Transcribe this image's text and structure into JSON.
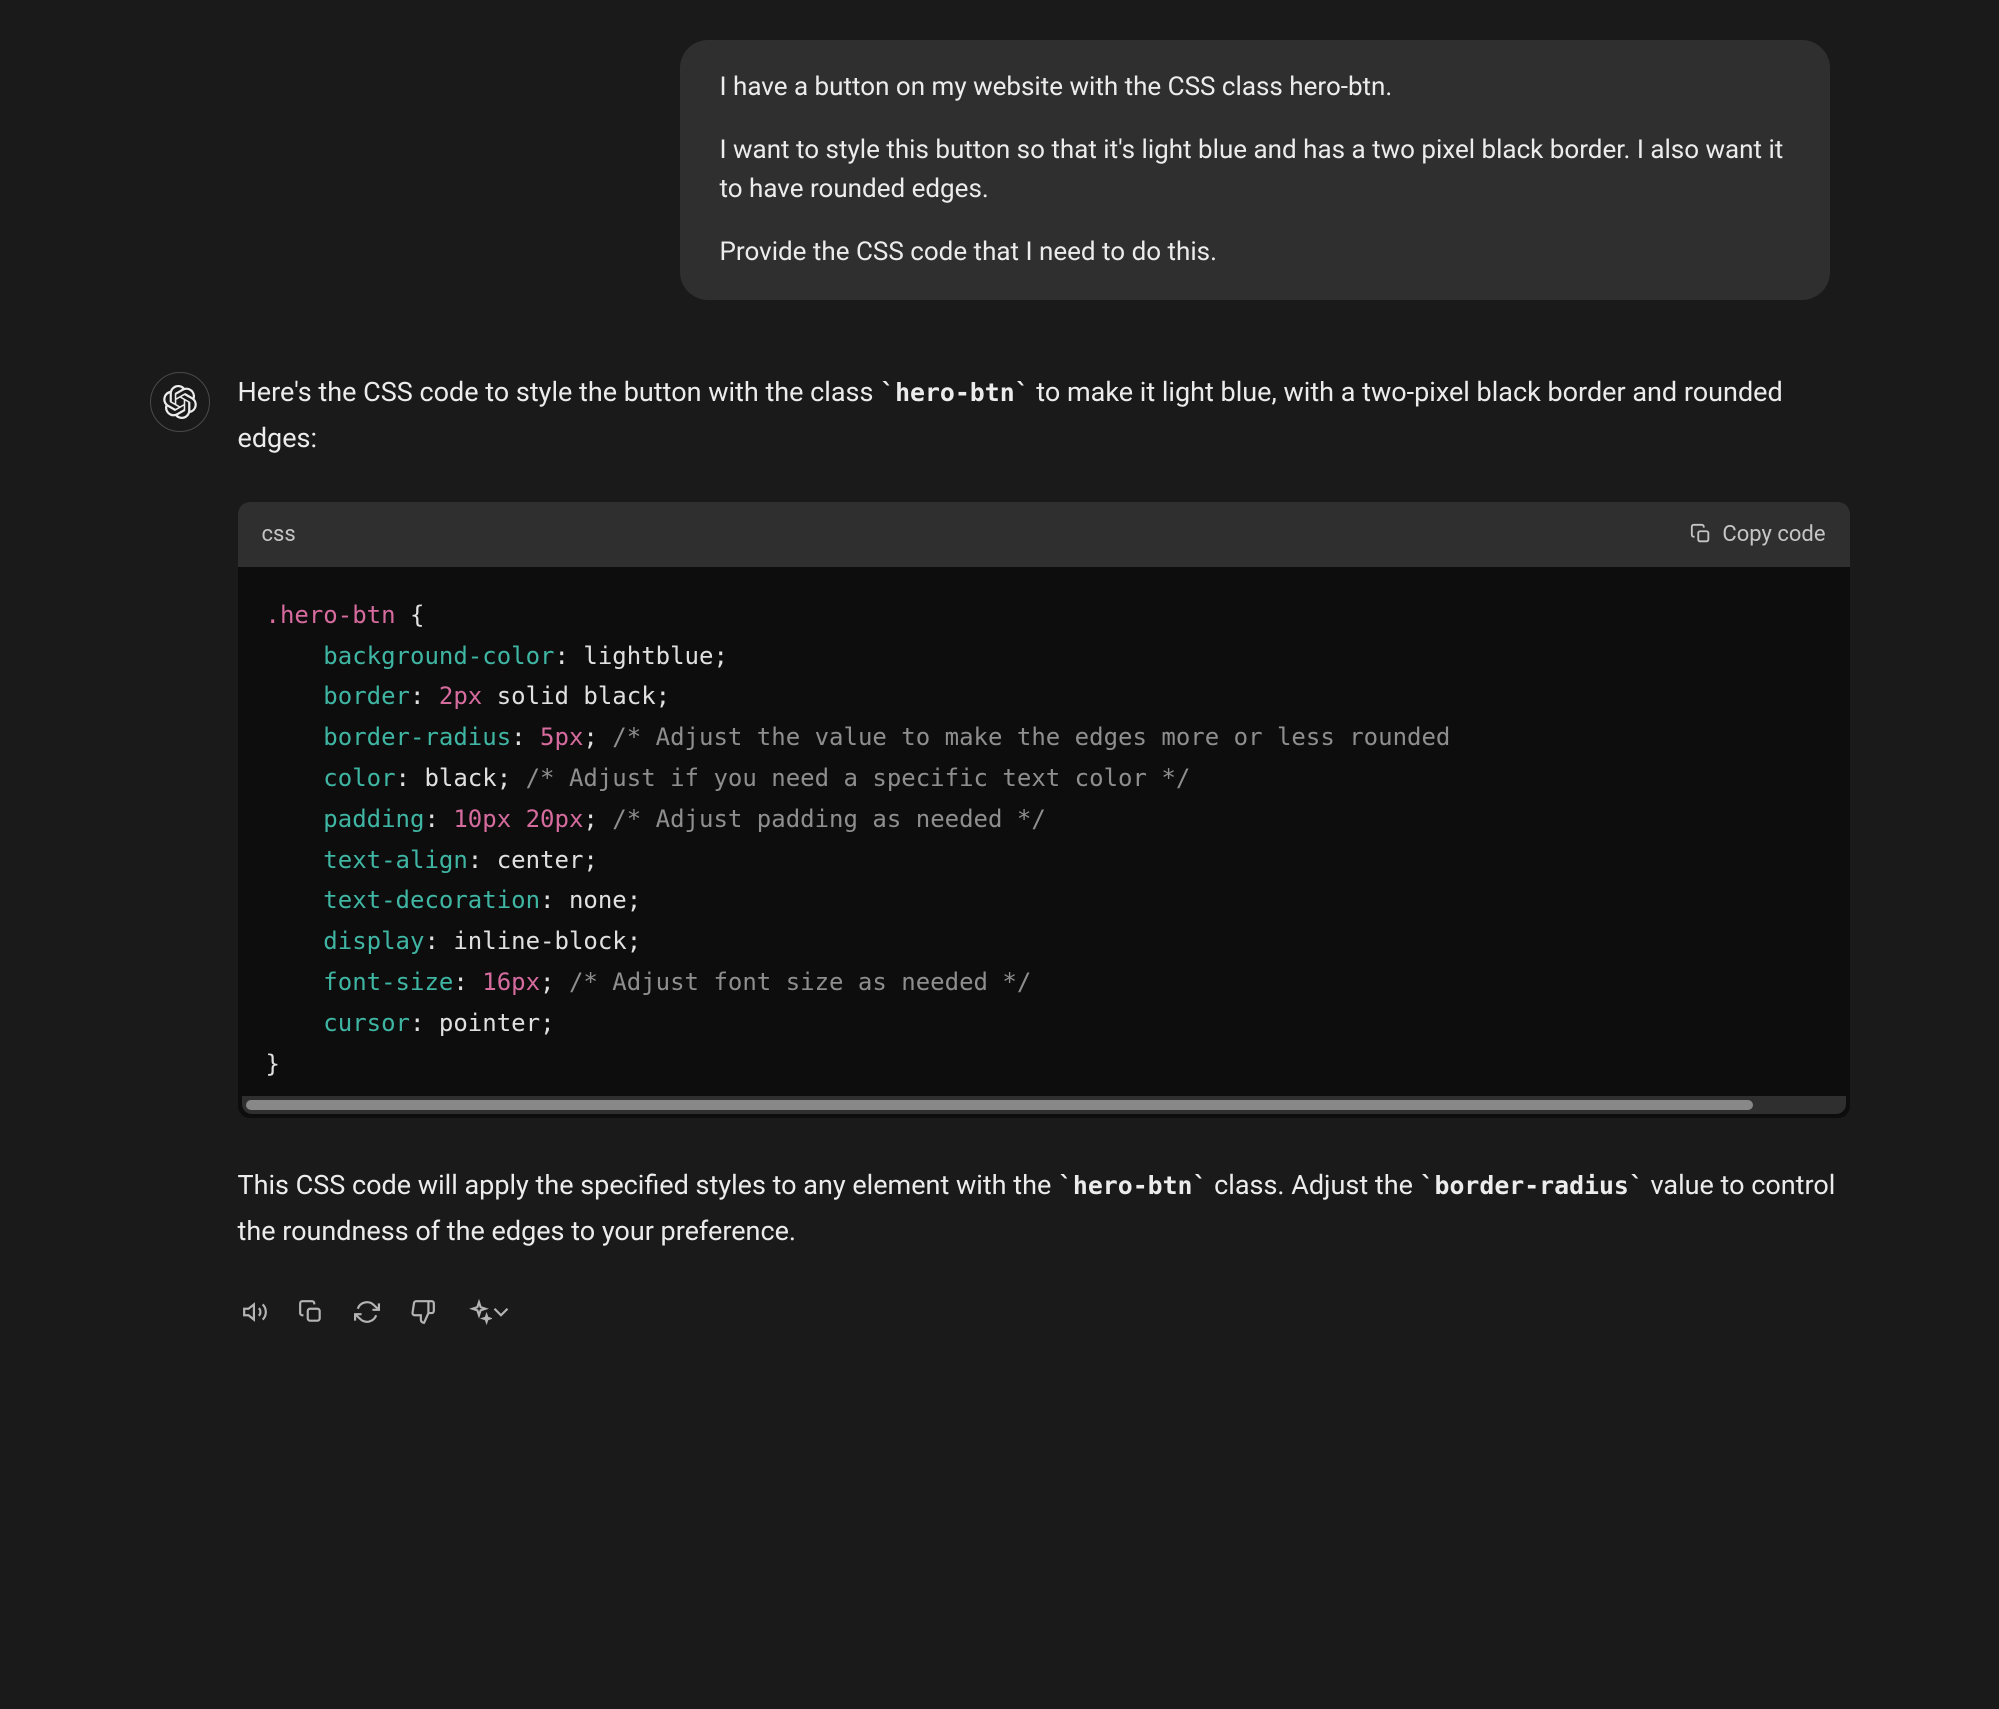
{
  "user_message": {
    "p1": "I have a button on my website with the CSS class hero-btn.",
    "p2": "I want to style this button so that it's light blue and has a two pixel black border. I also want it to have rounded edges.",
    "p3": "Provide the CSS code that I need to do this."
  },
  "assistant": {
    "intro_before": "Here's the CSS code to style the button with the class ",
    "intro_code": "`hero-btn`",
    "intro_after": " to make it light blue, with a two-pixel black border and rounded edges:",
    "outro_before": "This CSS code will apply the specified styles to any element with the ",
    "outro_code1": "`hero-btn`",
    "outro_mid": " class. Adjust the ",
    "outro_code2": "`border-radius`",
    "outro_after": " value to control the roundness of the edges to your preference."
  },
  "code_block": {
    "language": "css",
    "copy_label": "Copy code",
    "lines": [
      {
        "type": "selector-open",
        "selector": ".hero-btn",
        "brace": " {"
      },
      {
        "type": "decl",
        "indent": "    ",
        "prop": "background-color",
        "colon": ": ",
        "value": "lightblue",
        "semi": ";"
      },
      {
        "type": "decl",
        "indent": "    ",
        "prop": "border",
        "colon": ": ",
        "num": "2px",
        "value": " solid black",
        "semi": ";"
      },
      {
        "type": "decl",
        "indent": "    ",
        "prop": "border-radius",
        "colon": ": ",
        "num": "5px",
        "semi": ";",
        "comment": " /* Adjust the value to make the edges more or less rounded"
      },
      {
        "type": "decl",
        "indent": "    ",
        "prop": "color",
        "colon": ": ",
        "value": "black",
        "semi": ";",
        "comment": " /* Adjust if you need a specific text color */"
      },
      {
        "type": "decl",
        "indent": "    ",
        "prop": "padding",
        "colon": ": ",
        "num": "10px",
        "num2": " 20px",
        "semi": ";",
        "comment": " /* Adjust padding as needed */"
      },
      {
        "type": "decl",
        "indent": "    ",
        "prop": "text-align",
        "colon": ": ",
        "value": "center",
        "semi": ";"
      },
      {
        "type": "decl",
        "indent": "    ",
        "prop": "text-decoration",
        "colon": ": ",
        "value": "none",
        "semi": ";"
      },
      {
        "type": "decl",
        "indent": "    ",
        "prop": "display",
        "colon": ": ",
        "value": "inline-block",
        "semi": ";"
      },
      {
        "type": "decl",
        "indent": "    ",
        "prop": "font-size",
        "colon": ": ",
        "num": "16px",
        "semi": ";",
        "comment": " /* Adjust font size as needed */"
      },
      {
        "type": "decl",
        "indent": "    ",
        "prop": "cursor",
        "colon": ": ",
        "value": "pointer",
        "semi": ";"
      },
      {
        "type": "close",
        "brace": "}"
      }
    ]
  },
  "actions": {
    "speak": "Read aloud",
    "copy": "Copy",
    "regenerate": "Regenerate",
    "dislike": "Bad response",
    "switch": "Change model"
  }
}
